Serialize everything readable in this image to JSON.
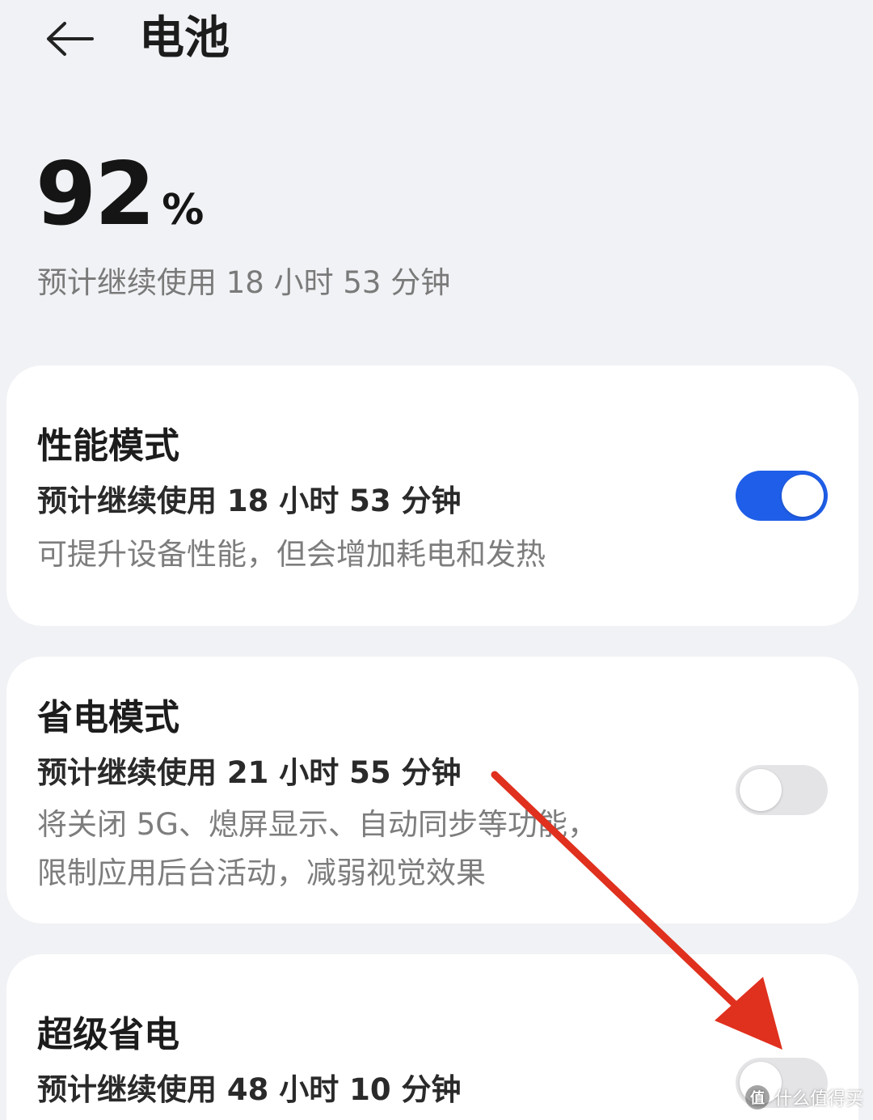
{
  "header": {
    "title": "电池",
    "back_icon": "arrow-left-icon"
  },
  "battery": {
    "level": "92",
    "unit": "%",
    "estimate": "预计继续使用 18 小时 53 分钟"
  },
  "modes": [
    {
      "title": "性能模式",
      "estimate": "预计继续使用 18 小时 53 分钟",
      "description": "可提升设备性能，但会增加耗电和发热",
      "enabled": true
    },
    {
      "title": "省电模式",
      "estimate": "预计继续使用 21 小时 55 分钟",
      "description_line1": "将关闭 5G、熄屏显示、自动同步等功能，",
      "description_line2": "限制应用后台活动，减弱视觉效果",
      "enabled": false
    },
    {
      "title": "超级省电",
      "estimate": "预计继续使用 48 小时 10 分钟",
      "enabled": false
    }
  ],
  "colors": {
    "toggle_on": "#1f5ee8",
    "toggle_off": "#e4e4e6",
    "annotation_arrow": "#e0301e"
  },
  "watermark": {
    "text": "什么值得买",
    "badge": "值"
  }
}
